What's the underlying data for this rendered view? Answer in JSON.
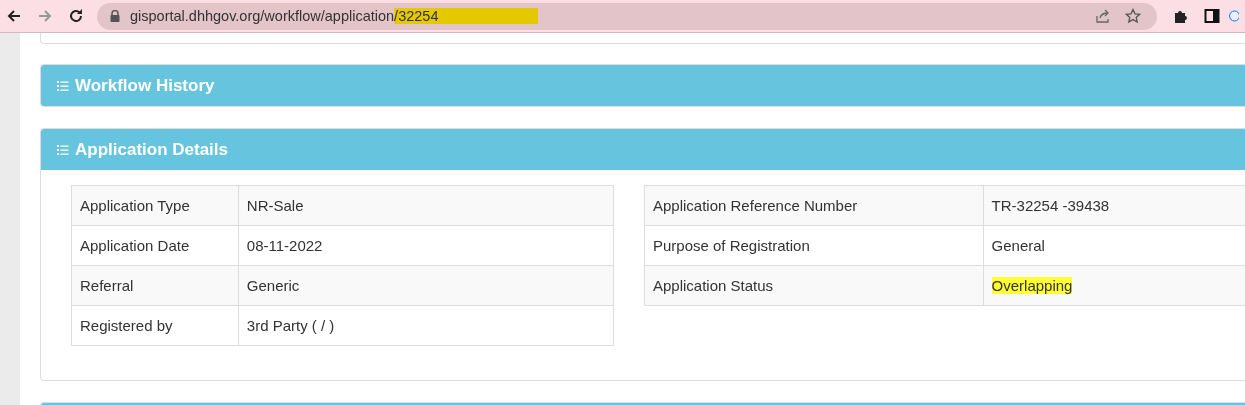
{
  "browser": {
    "url_parts": [
      {
        "text": "gisportal.dhhgov.org/workflow/application",
        "highlighted": false
      },
      {
        "text": "/32254",
        "highlighted": true
      }
    ]
  },
  "panels": [
    {
      "title": "Workflow History",
      "expanded": false
    },
    {
      "title": "Application Details",
      "expanded": true,
      "left_table": [
        {
          "label": "Application Type",
          "value": "NR-Sale",
          "highlighted": false
        },
        {
          "label": "Application Date",
          "value": "08-11-2022",
          "highlighted": false
        },
        {
          "label": "Referral",
          "value": "Generic",
          "highlighted": false
        },
        {
          "label": "Registered by",
          "value": "3rd Party ( / )",
          "highlighted": false
        }
      ],
      "right_table": [
        {
          "label": "Application Reference Number",
          "value": "TR-32254 -39438",
          "highlighted": false
        },
        {
          "label": "Purpose of Registration",
          "value": "General",
          "highlighted": false
        },
        {
          "label": "Application Status",
          "value": "Overlapping",
          "highlighted": true
        }
      ]
    }
  ]
}
